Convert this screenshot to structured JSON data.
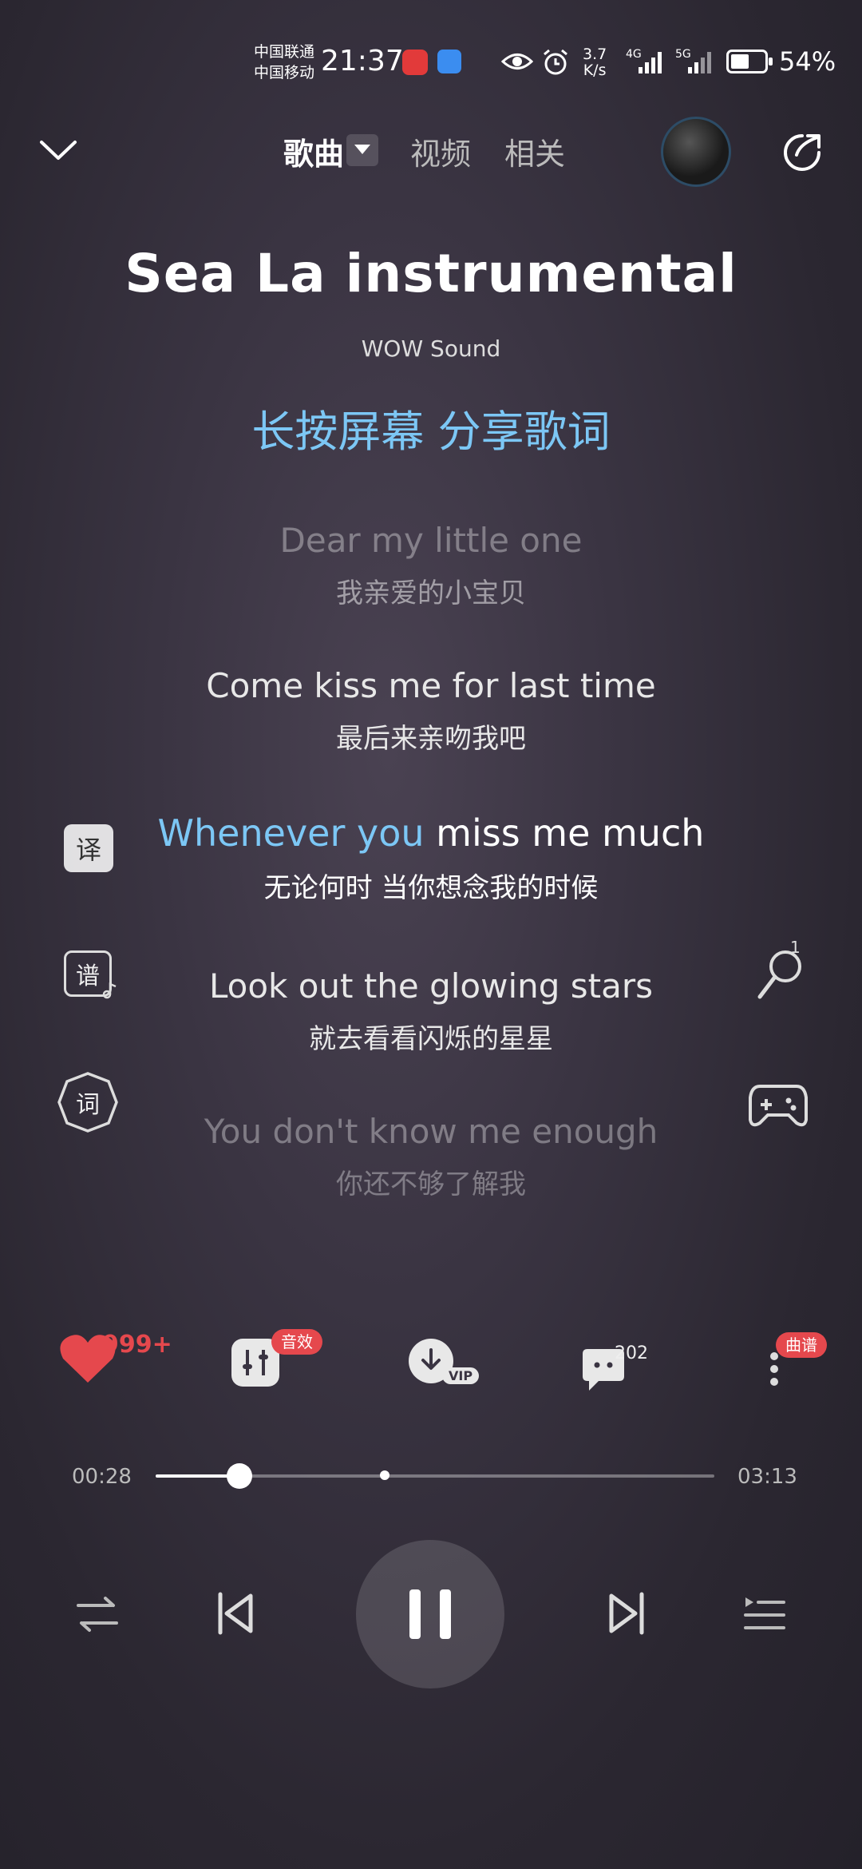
{
  "status": {
    "carrier1": "中国联通",
    "carrier2": "中国移动",
    "time": "21:37",
    "speed_value": "3.7",
    "speed_unit": "K/s",
    "net1": "4G",
    "net2": "5G",
    "battery_pct": "54%",
    "battery_level": 0.54
  },
  "header": {
    "tab_song": "歌曲",
    "tab_video": "视频",
    "tab_related": "相关"
  },
  "song": {
    "title": "Sea La instrumental",
    "artist": "WOW Sound",
    "share_hint_1": "长按屏幕",
    "share_hint_2": "分享歌词"
  },
  "lyrics": [
    {
      "en": "Dear my little one",
      "zh": "我亲爱的小宝贝"
    },
    {
      "en": "Come kiss me for last time",
      "zh": "最后来亲吻我吧"
    },
    {
      "en_hl": "Whenever you",
      "en_rest": " miss me much",
      "zh": "无论何时 当你想念我的时候"
    },
    {
      "en": "Look out the glowing stars",
      "zh": "就去看看闪烁的星星"
    },
    {
      "en": "You don't know me enough",
      "zh": "你还不够了解我"
    }
  ],
  "side_left": {
    "translate_label": "译",
    "score_label": "谱",
    "lyric_label": "词"
  },
  "side_right": {
    "karaoke_count": "1"
  },
  "actions": {
    "like_count": "999+",
    "effects_badge": "音效",
    "download_badge": "VIP",
    "comment_count": "202",
    "score_badge": "曲谱"
  },
  "progress": {
    "current": "00:28",
    "total": "03:13",
    "played_fraction": 0.15,
    "buffered_fraction": 0.41
  },
  "colors": {
    "accent": "#7cc7f5",
    "like": "#e5484d"
  }
}
